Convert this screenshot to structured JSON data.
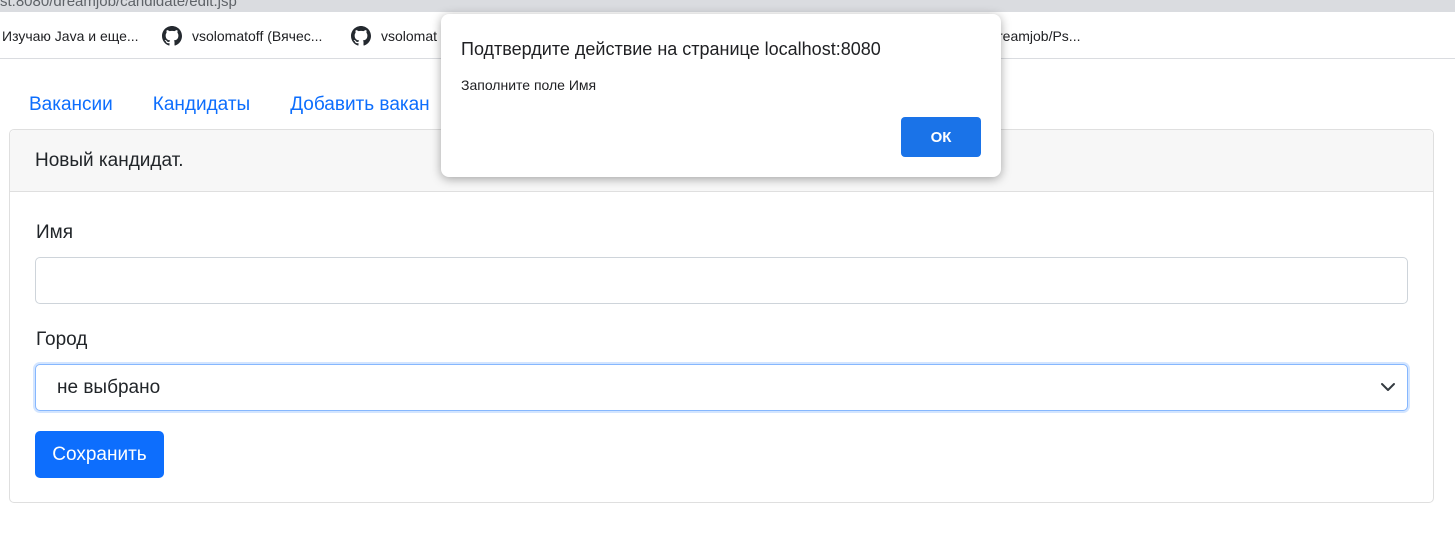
{
  "browser": {
    "url_fragment": "st:8080/dreamjob/candidate/edit.jsp",
    "bookmarks": [
      {
        "label": "Изучаю Java и еще...",
        "icon": "none"
      },
      {
        "label": "vsolomatoff (Вячес...",
        "icon": "github-icon"
      },
      {
        "label": "vsolomat",
        "icon": "github-icon"
      },
      {
        "label": "reamjob/Ps...",
        "icon": "none"
      }
    ]
  },
  "nav": {
    "items": [
      "Вакансии",
      "Кандидаты",
      "Добавить вакан"
    ]
  },
  "card": {
    "header": "Новый кандидат.",
    "name_label": "Имя",
    "name_value": "",
    "city_label": "Город",
    "city_selected": "не выбрано",
    "save_label": "Сохранить"
  },
  "dialog": {
    "title": "Подтвердите действие на странице localhost:8080",
    "message": "Заполните поле Имя",
    "ok_label": "ОК"
  },
  "colors": {
    "link": "#0d6efd",
    "primary_button": "#0d6efd",
    "dialog_button": "#1a73e8"
  }
}
